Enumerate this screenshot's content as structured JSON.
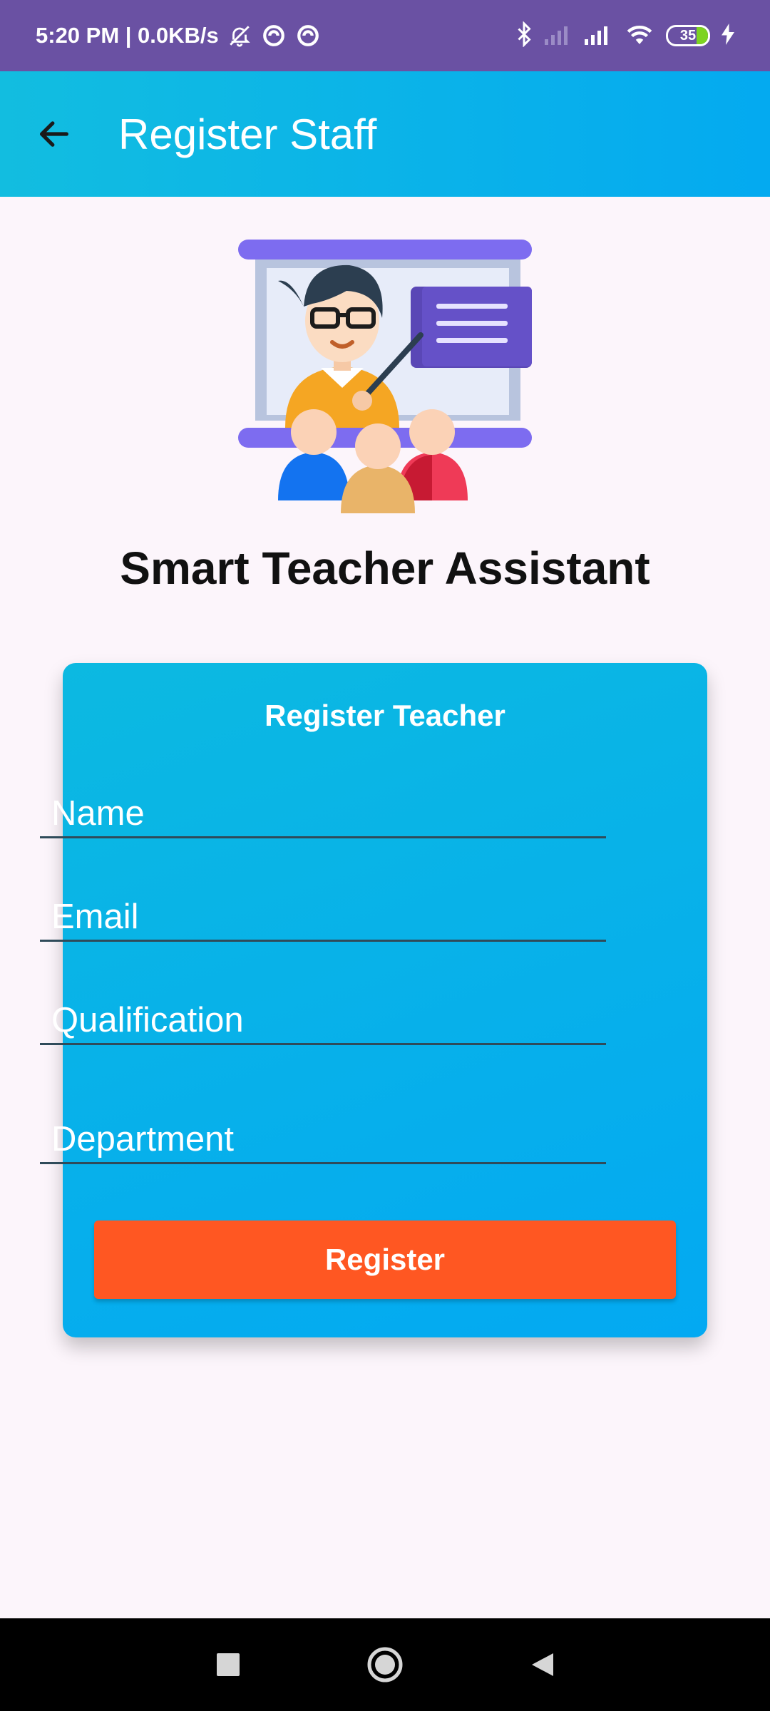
{
  "status_bar": {
    "time_speed": "5:20 PM | 0.0KB/s",
    "battery": "35",
    "icons": [
      "mute-icon",
      "sync-icon",
      "sync-icon",
      "bluetooth-icon",
      "signal-icon",
      "signal-icon",
      "wifi-icon",
      "battery-icon",
      "charging-icon"
    ]
  },
  "app_bar": {
    "title": "Register Staff",
    "back_icon": "arrow-left-icon"
  },
  "hero": {
    "image": "teacher-illustration",
    "app_name": "Smart Teacher Assistant"
  },
  "form": {
    "title": "Register Teacher",
    "fields": [
      {
        "placeholder": "Name",
        "value": ""
      },
      {
        "placeholder": "Email",
        "value": ""
      },
      {
        "placeholder": "Qualification",
        "value": ""
      },
      {
        "placeholder": "Department",
        "value": ""
      }
    ],
    "submit_label": "Register"
  },
  "nav_bar": {
    "buttons": [
      "recents-square-icon",
      "home-circle-icon",
      "back-triangle-icon"
    ]
  },
  "colors": {
    "status_bar": "#6a51a3",
    "app_bar": "#0aafe8",
    "card": "#07b1ea",
    "button": "#ff5722",
    "background": "#fcf5fb"
  }
}
